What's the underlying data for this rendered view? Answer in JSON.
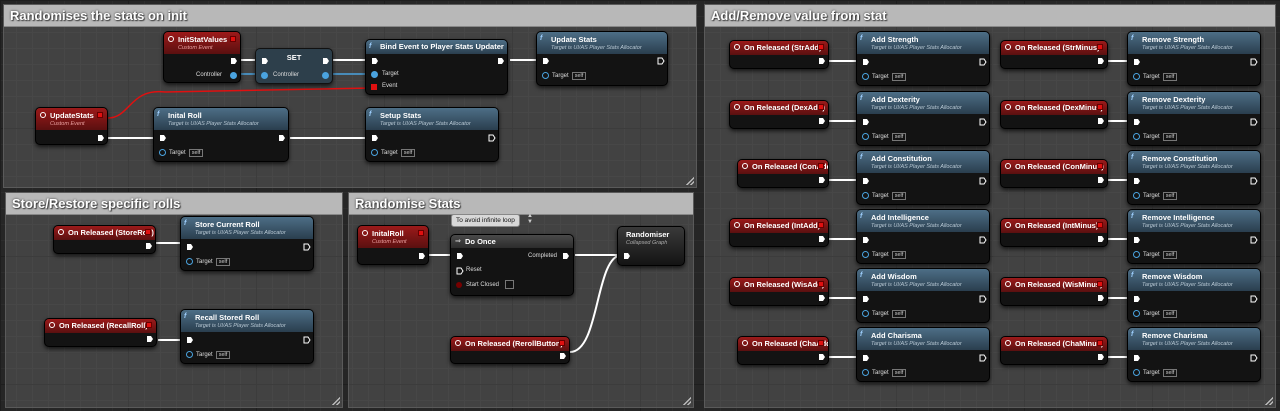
{
  "colors": {
    "exec": "#ffffff",
    "object_pin": "#4aa3df",
    "event_head": "#9c1a1a",
    "func_head": "#4d6e86",
    "wire_red": "#e01010"
  },
  "comments": {
    "randomise_init": "Randomises the stats on init",
    "store_restore": "Store/Restore specific rolls",
    "randomise_stats": "Randomise Stats",
    "add_remove": "Add/Remove value from stat"
  },
  "common": {
    "custom_event": "Custom Event",
    "target_sub": "Target is UI/AS Player Stats Allocator",
    "target": "Target",
    "self": "self",
    "event": "Event",
    "controller": "Controller"
  },
  "init_section": {
    "init_stat_values": "InitStatValues",
    "set": "SET",
    "bind_event": "Bind Event to Player Stats Updater",
    "update_stats_fn": "Update Stats",
    "update_stats_event": "UpdateStats",
    "initial_roll": "Inital Roll",
    "setup_stats": "Setup Stats"
  },
  "store_section": {
    "on_released_store": "On Released (StoreRoll)",
    "store_current_roll": "Store Current Roll",
    "on_released_recall": "On Released (RecallRoll)",
    "recall_stored_roll": "Recall Stored Roll"
  },
  "randomise_section": {
    "inital_roll_event": "InitalRoll",
    "tooltip": "To avoid infinite loop",
    "do_once": "Do Once",
    "completed": "Completed",
    "reset": "Reset",
    "start_closed": "Start Closed",
    "randomiser": "Randomiser",
    "collapsed_graph": "Collapsed Graph",
    "on_released_reroll": "On Released (RerollButton)"
  },
  "stats_rows": [
    {
      "add_event": "On Released (StrAdd)",
      "add_fn": "Add Strength",
      "minus_event": "On Released (StrMinus)",
      "remove_fn": "Remove Strength"
    },
    {
      "add_event": "On Released (DexAdd)",
      "add_fn": "Add Dexterity",
      "minus_event": "On Released (DexMinus)",
      "remove_fn": "Remove Dexterity"
    },
    {
      "add_event": "On Released (ConAdd)",
      "add_fn": "Add Constitution",
      "minus_event": "On Released (ConMinus)",
      "remove_fn": "Remove Constitution"
    },
    {
      "add_event": "On Released (IntAdd)",
      "add_fn": "Add Intelligence",
      "minus_event": "On Released (IntMinus)",
      "remove_fn": "Remove Intelligence"
    },
    {
      "add_event": "On Released (WisAdd)",
      "add_fn": "Add Wisdom",
      "minus_event": "On Released (WisMinus)",
      "remove_fn": "Remove Wisdom"
    },
    {
      "add_event": "On Released (ChaAdd)",
      "add_fn": "Add Charisma",
      "minus_event": "On Released (ChaMinus)",
      "remove_fn": "Remove Charisma"
    }
  ]
}
